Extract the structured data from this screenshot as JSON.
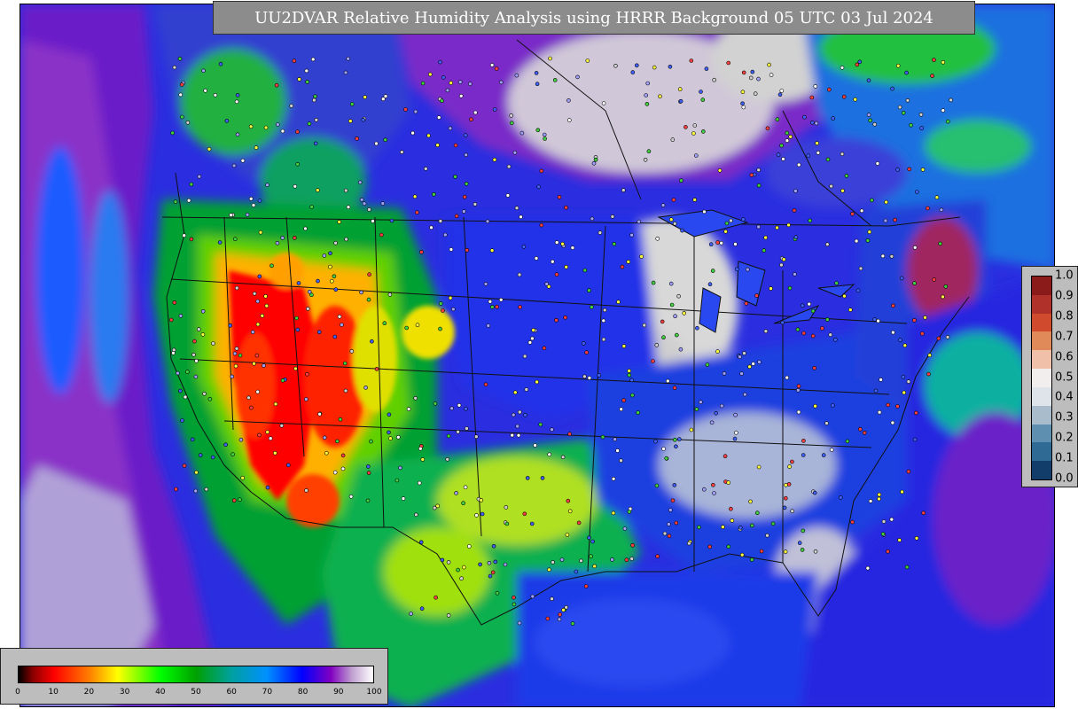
{
  "title": "UU2DVAR Relative Humidity Analysis using HRRR Background 05 UTC 03 Jul 2024",
  "rh_legend": {
    "ticks": [
      "0",
      "10",
      "20",
      "30",
      "40",
      "50",
      "60",
      "70",
      "80",
      "90",
      "100"
    ],
    "range": [
      0,
      100
    ]
  },
  "difference_legend": {
    "ticks": [
      "1.0",
      "0.9",
      "0.8",
      "0.7",
      "0.6",
      "0.5",
      "0.4",
      "0.3",
      "0.2",
      "0.1",
      "0.0"
    ],
    "range": [
      0.0,
      1.0
    ],
    "colors": [
      "#8b1a1a",
      "#b0302a",
      "#d04a2e",
      "#e08a5a",
      "#f0c0a8",
      "#f2eeee",
      "#dfe4ea",
      "#a8bccb",
      "#5f8fb0",
      "#2f6a94",
      "#123c6a"
    ]
  },
  "colors": {
    "ocean_humid": "#1a2ed8",
    "saturated": "#c8c8c8",
    "dry_core": "#ff0000",
    "panel_gray": "#bdbdbd",
    "title_box": "#8c8c8c"
  }
}
